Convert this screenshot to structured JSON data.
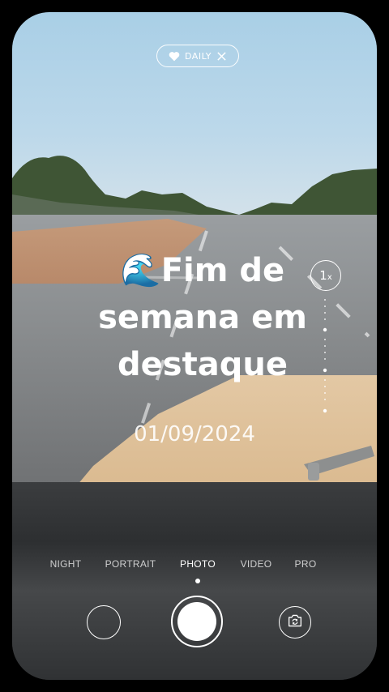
{
  "badge": {
    "label": "DAILY",
    "icon": "heart-icon",
    "close_icon": "close-icon"
  },
  "headline": {
    "emoji": "🌊",
    "text": "Fim de semana em destaque"
  },
  "date": "01/09/2024",
  "zoom": {
    "value": "1",
    "unit": "x"
  },
  "modes": [
    {
      "label": "NIGHT",
      "active": false
    },
    {
      "label": "PORTRAIT",
      "active": false
    },
    {
      "label": "PHOTO",
      "active": true
    },
    {
      "label": "VIDEO",
      "active": false
    },
    {
      "label": "PRO",
      "active": false
    }
  ],
  "controls": {
    "gallery_icon": "gallery-thumbnail",
    "shutter_icon": "shutter-icon",
    "flip_icon": "camera-flip-icon"
  },
  "colors": {
    "overlay_text": "#ffffff",
    "background": "#000000"
  }
}
